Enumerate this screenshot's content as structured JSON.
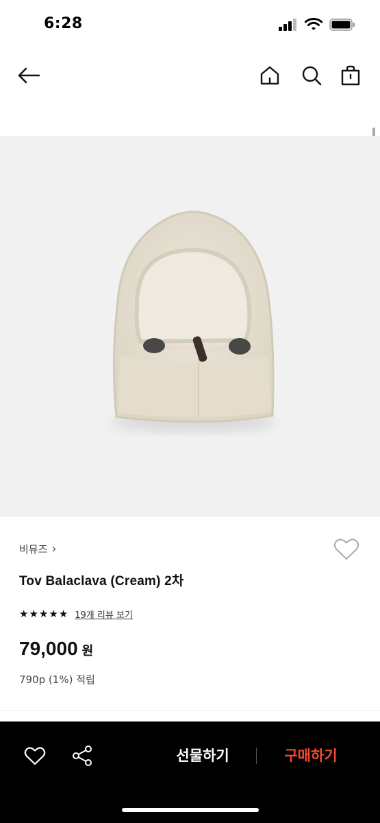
{
  "status_bar": {
    "time": "6:28"
  },
  "nav": {
    "back_icon": "arrow-left-icon",
    "home_icon": "home-icon",
    "search_icon": "search-icon",
    "bag_icon": "shopping-bag-icon"
  },
  "product": {
    "brand": "비뮤즈",
    "brand_chevron": "›",
    "title": "Tov Balaclava (Cream) 2차",
    "rating_stars": 5,
    "review_link": "19개 리뷰 보기",
    "price": "79,000",
    "currency": "원",
    "points": "790p (1%) 적립"
  },
  "bottom_bar": {
    "gift_label": "선물하기",
    "buy_label": "구매하기",
    "wish_icon": "heart-outline-icon",
    "share_icon": "share-icon"
  },
  "colors": {
    "accent": "#f04b2c",
    "image_bg": "#f1f1f1",
    "bar_bg": "#000000"
  }
}
